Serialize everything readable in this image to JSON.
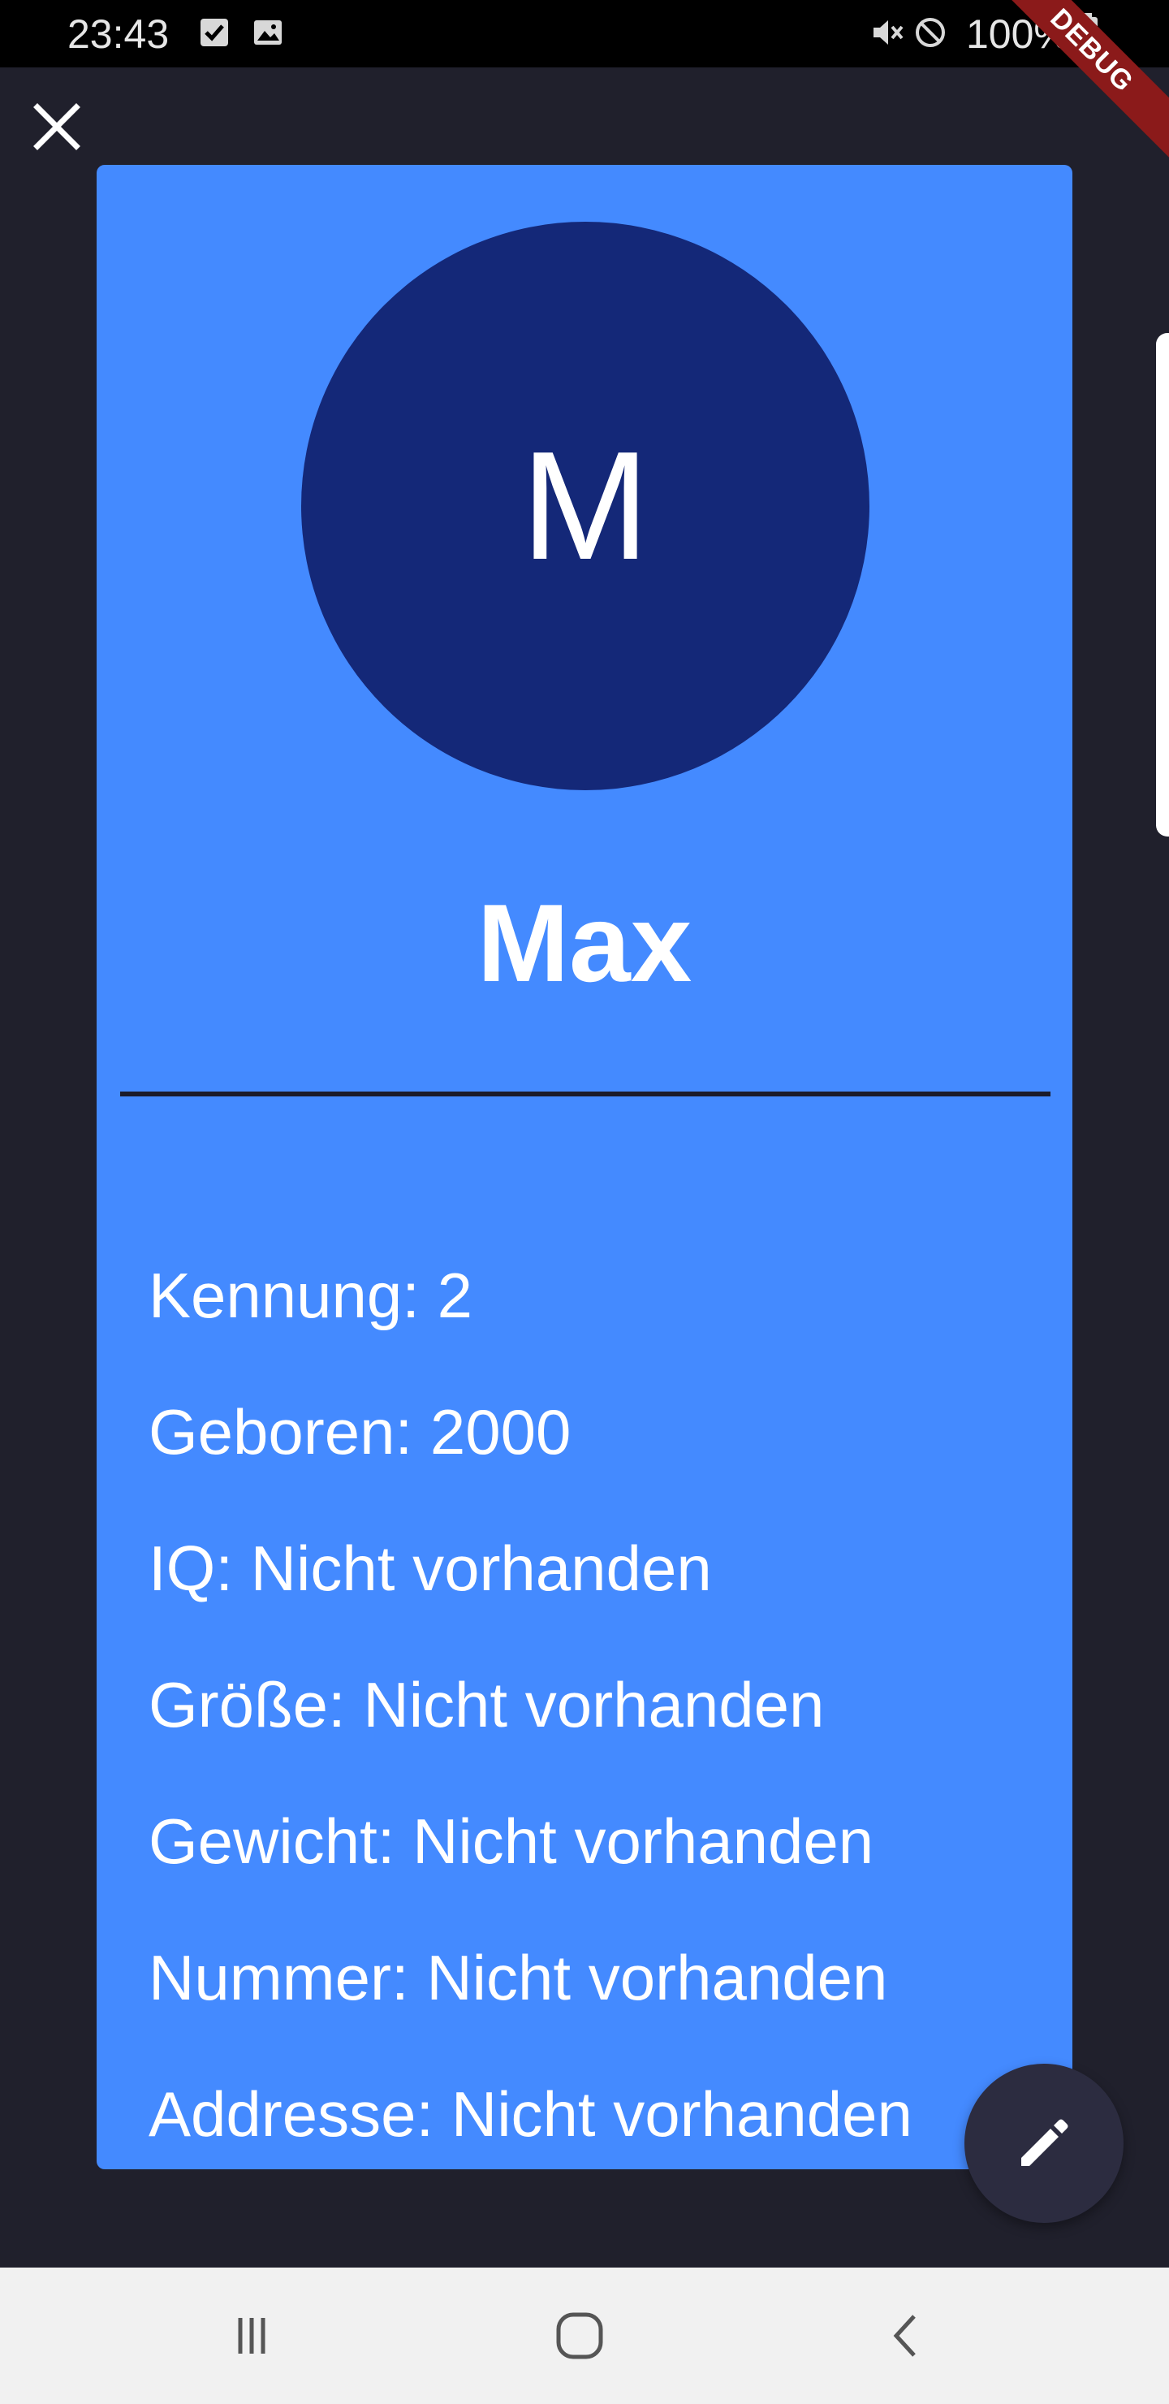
{
  "status_bar": {
    "time": "23:43",
    "battery": "100%",
    "icons": [
      "checkbox-icon",
      "image-icon",
      "mute-icon",
      "do-not-disturb-icon",
      "battery-icon"
    ]
  },
  "debug_ribbon": {
    "label": "DEBUG"
  },
  "header": {
    "close_icon": "close-icon"
  },
  "profile": {
    "avatar_letter": "M",
    "name": "Max",
    "details": [
      "Kennung: 2",
      "Geboren: 2000",
      "IQ: Nicht vorhanden",
      "Größe: Nicht vorhanden",
      "Gewicht: Nicht vorhanden",
      "Nummer: Nicht vorhanden",
      "Addresse: Nicht vorhanden"
    ]
  },
  "fab": {
    "icon": "pencil-icon"
  },
  "navigation": {
    "buttons": [
      "recent-apps-icon",
      "home-icon",
      "back-icon"
    ]
  },
  "colors": {
    "background": "#20202c",
    "card": "#448aff",
    "avatar": "#142878",
    "fab": "#2c2c40",
    "status_bar": "#000000",
    "nav_bar": "#f1f1f1",
    "debug_ribbon": "#8b1a1a"
  }
}
